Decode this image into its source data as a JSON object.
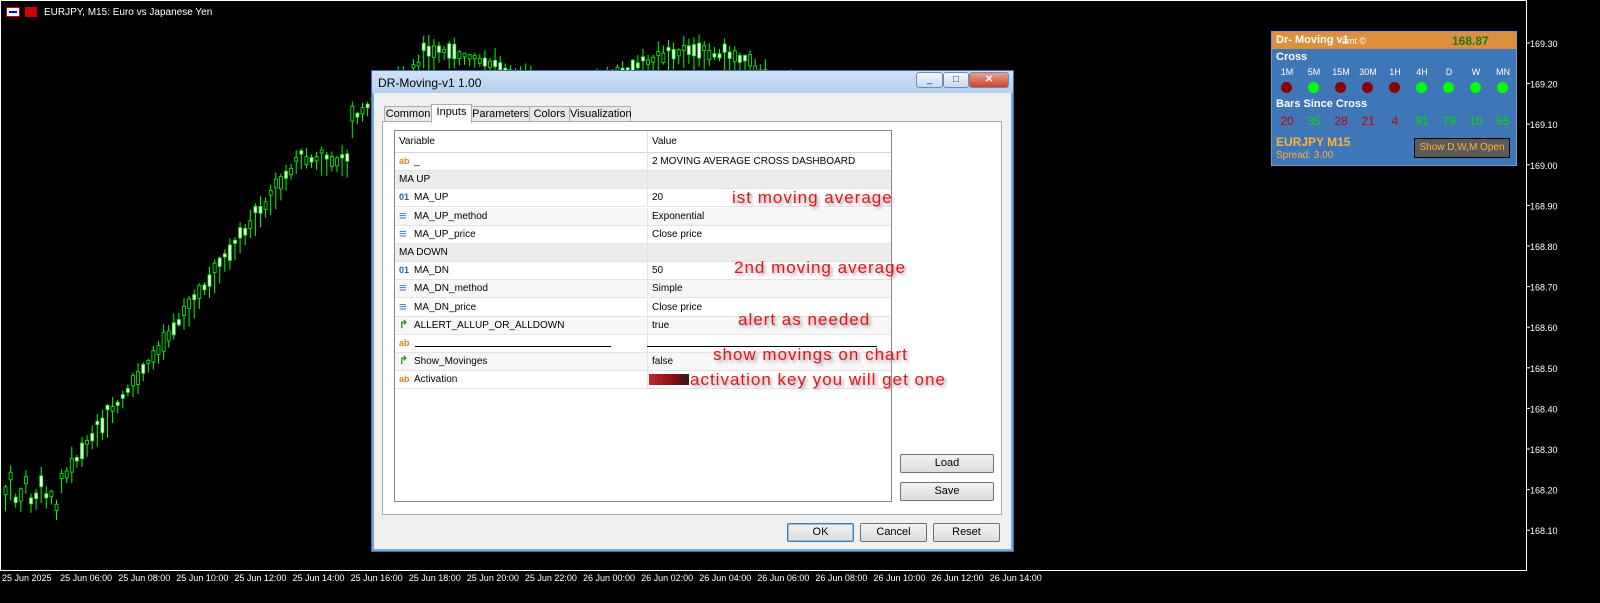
{
  "chart": {
    "symbol_title": "EURJPY, M15:  Euro vs Japanese Yen",
    "price_ticks": [
      "169.30",
      "169.20",
      "169.10",
      "169.00",
      "168.90",
      "168.80",
      "168.70",
      "168.60",
      "168.50",
      "168.40",
      "168.30",
      "168.20",
      "168.10"
    ],
    "time_ticks": [
      "25 Jun 2025",
      "25 Jun 06:00",
      "25 Jun 08:00",
      "25 Jun 10:00",
      "25 Jun 12:00",
      "25 Jun 14:00",
      "25 Jun 16:00",
      "25 Jun 18:00",
      "25 Jun 20:00",
      "25 Jun 22:00",
      "26 Jun 00:00",
      "26 Jun 02:00",
      "26 Jun 04:00",
      "26 Jun 06:00",
      "26 Jun 08:00",
      "26 Jun 10:00",
      "26 Jun 12:00",
      "26 Jun 14:00"
    ],
    "candle_color": "#00ff00",
    "background": "#000000"
  },
  "dialog": {
    "title": "DR-Moving-v1 1.00",
    "tabs": [
      "Common",
      "Inputs",
      "Parameters",
      "Colors",
      "Visualization"
    ],
    "active_tab": "Inputs",
    "columns": {
      "variable": "Variable",
      "value": "Value"
    },
    "rows": [
      {
        "icon": "ab",
        "variable": "_",
        "value": "2 MOVING AVERAGE CROSS DASHBOARD"
      },
      {
        "icon": "",
        "variable": "MA UP",
        "value": ""
      },
      {
        "icon": "01",
        "variable": "MA_UP",
        "value": "20"
      },
      {
        "icon": "enum",
        "variable": "MA_UP_method",
        "value": "Exponential"
      },
      {
        "icon": "enum",
        "variable": "MA_UP_price",
        "value": "Close price"
      },
      {
        "icon": "",
        "variable": "MA DOWN",
        "value": ""
      },
      {
        "icon": "01",
        "variable": "MA_DN",
        "value": "50"
      },
      {
        "icon": "enum",
        "variable": "MA_DN_method",
        "value": "Simple"
      },
      {
        "icon": "enum",
        "variable": "MA_DN_price",
        "value": "Close price"
      },
      {
        "icon": "bool",
        "variable": "ALLERT_ALLUP_OR_ALLDOWN",
        "value": "true"
      },
      {
        "icon": "ab",
        "variable": "",
        "value": ""
      },
      {
        "icon": "bool",
        "variable": "Show_Movinges",
        "value": "false"
      },
      {
        "icon": "ab",
        "variable": "Activation",
        "value": ""
      }
    ],
    "buttons": {
      "load": "Load",
      "save": "Save",
      "ok": "OK",
      "cancel": "Cancel",
      "reset": "Reset"
    },
    "window_buttons": {
      "minimize": "_",
      "maximize": "□",
      "close": "✕"
    }
  },
  "annotations": [
    "ist moving average",
    "2nd moving average",
    "alert as needed",
    "show movings on chart",
    "activation key you will get one"
  ],
  "dashboard": {
    "title": "Dr- Moving v1",
    "subtitle": "amt ©",
    "price": "168.87",
    "cross_label": "Cross",
    "timeframes": [
      "1M",
      "5M",
      "15M",
      "30M",
      "1H",
      "4H",
      "D",
      "W",
      "MN"
    ],
    "cross_status": [
      "down",
      "up",
      "down",
      "down",
      "down",
      "up",
      "up",
      "up",
      "up"
    ],
    "bars_since_label": "Bars Since Cross",
    "bars_since": [
      "20",
      "35",
      "28",
      "21",
      "4",
      "91",
      "79",
      "10",
      "55"
    ],
    "symbol": "EURJPY  M15",
    "spread": "Spread: 3.00",
    "button": "Show D,W,M Open",
    "colors": {
      "up": "#00ff00",
      "down": "#8b0000",
      "up_text": "#00e000",
      "down_text": "#c80000"
    }
  }
}
